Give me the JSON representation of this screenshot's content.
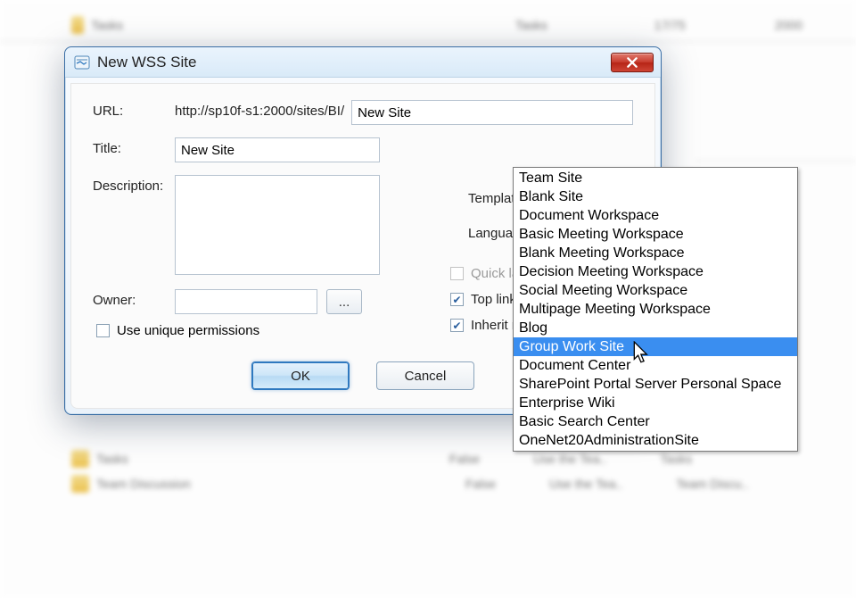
{
  "dialog": {
    "title": "New WSS Site",
    "labels": {
      "url": "URL:",
      "title": "Title:",
      "description": "Description:",
      "owner": "Owner:",
      "template": "Template:",
      "language": "Language:",
      "unique_permissions": "Use unique permissions"
    },
    "url_prefix": "http://sp10f-s1:2000/sites/BI/",
    "url_value": "New Site",
    "title_value": "New Site",
    "description_value": "",
    "owner_value": "",
    "owner_browse": "...",
    "template_selected": "Document Center",
    "checkboxes": {
      "quick_launch": "Quick la",
      "top_link": "Top link",
      "inherit_nav": "Inherit n"
    },
    "buttons": {
      "ok": "OK",
      "cancel": "Cancel"
    }
  },
  "template_options": [
    "Team Site",
    "Blank Site",
    "Document Workspace",
    "Basic Meeting Workspace",
    "Blank Meeting Workspace",
    "Decision Meeting Workspace",
    "Social Meeting Workspace",
    "Multipage Meeting Workspace",
    "Blog",
    "Group Work Site",
    "Document Center",
    "SharePoint Portal Server Personal Space",
    "Enterprise Wiki",
    "Basic Search Center",
    "OneNet20AdministrationSite"
  ],
  "template_highlight_index": 9,
  "bg_rows": {
    "r0_name": "Tasks",
    "r0_c3": "Tasks",
    "r0_c4": "17/75",
    "r0_c5": "2000",
    "r1_name": "Tasks",
    "r2_name": "Team Discussion",
    "r1_c3": "False",
    "r2_c3": "False",
    "r1_c4": "Use the Tea..",
    "r2_c4": "Use the Tea..",
    "r1_c5": "Tasks",
    "r2_c5": "Team Discu.."
  }
}
